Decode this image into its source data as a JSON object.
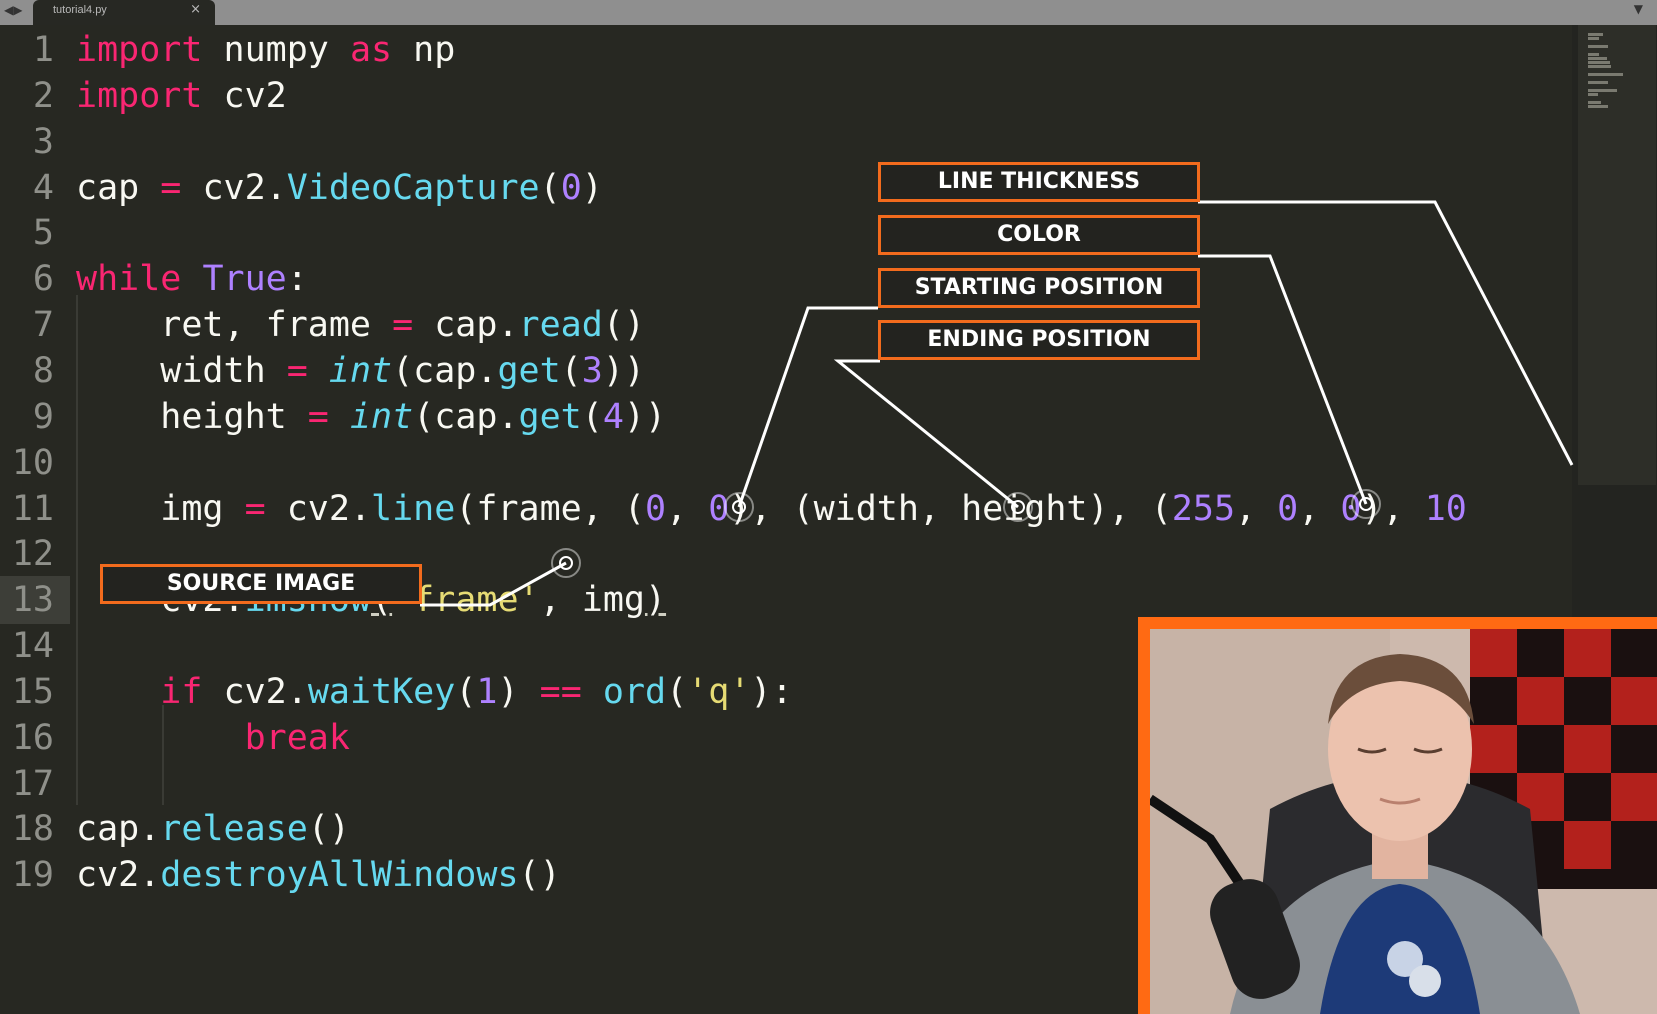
{
  "tab": {
    "filename": "tutorial4.py",
    "close_glyph": "×"
  },
  "line_numbers": [
    "1",
    "2",
    "3",
    "4",
    "5",
    "6",
    "7",
    "8",
    "9",
    "10",
    "11",
    "12",
    "13",
    "14",
    "15",
    "16",
    "17",
    "18",
    "19"
  ],
  "code_lines": [
    [
      [
        "kw",
        "import"
      ],
      [
        "t",
        " numpy "
      ],
      [
        "kw",
        "as"
      ],
      [
        "t",
        " np"
      ]
    ],
    [
      [
        "kw",
        "import"
      ],
      [
        "t",
        " cv2"
      ]
    ],
    [],
    [
      [
        "t",
        "cap "
      ],
      [
        "op",
        "="
      ],
      [
        "t",
        " cv2."
      ],
      [
        "fn",
        "VideoCapture"
      ],
      [
        "t",
        "("
      ],
      [
        "num",
        "0"
      ],
      [
        "t",
        ")"
      ]
    ],
    [],
    [
      [
        "kw",
        "while"
      ],
      [
        "t",
        " "
      ],
      [
        "const",
        "True"
      ],
      [
        "t",
        ":"
      ]
    ],
    [
      [
        "t",
        "    ret, frame "
      ],
      [
        "op",
        "="
      ],
      [
        "t",
        " cap."
      ],
      [
        "fn",
        "read"
      ],
      [
        "t",
        "()"
      ]
    ],
    [
      [
        "t",
        "    width "
      ],
      [
        "op",
        "="
      ],
      [
        "t",
        " "
      ],
      [
        "builtin",
        "int"
      ],
      [
        "t",
        "(cap."
      ],
      [
        "fn",
        "get"
      ],
      [
        "t",
        "("
      ],
      [
        "num",
        "3"
      ],
      [
        "t",
        "))"
      ]
    ],
    [
      [
        "t",
        "    height "
      ],
      [
        "op",
        "="
      ],
      [
        "t",
        " "
      ],
      [
        "builtin",
        "int"
      ],
      [
        "t",
        "(cap."
      ],
      [
        "fn",
        "get"
      ],
      [
        "t",
        "("
      ],
      [
        "num",
        "4"
      ],
      [
        "t",
        "))"
      ]
    ],
    [],
    [
      [
        "t",
        "    img "
      ],
      [
        "op",
        "="
      ],
      [
        "t",
        " cv2."
      ],
      [
        "fn",
        "line"
      ],
      [
        "t",
        "(frame, ("
      ],
      [
        "num",
        "0"
      ],
      [
        "t",
        ", "
      ],
      [
        "num",
        "0"
      ],
      [
        "t",
        "), (width, height), ("
      ],
      [
        "num",
        "255"
      ],
      [
        "t",
        ", "
      ],
      [
        "num",
        "0"
      ],
      [
        "t",
        ", "
      ],
      [
        "num",
        "0"
      ],
      [
        "t",
        "), "
      ],
      [
        "num",
        "10"
      ]
    ],
    [],
    [
      [
        "t",
        "    cv2."
      ],
      [
        "fn",
        "imshow"
      ],
      [
        "u",
        "("
      ],
      [
        "str",
        "'frame'"
      ],
      [
        "t",
        ", img"
      ],
      [
        "u",
        ")"
      ]
    ],
    [],
    [
      [
        "t",
        "    "
      ],
      [
        "kw",
        "if"
      ],
      [
        "t",
        " cv2."
      ],
      [
        "fn",
        "waitKey"
      ],
      [
        "t",
        "("
      ],
      [
        "num",
        "1"
      ],
      [
        "t",
        ") "
      ],
      [
        "op",
        "=="
      ],
      [
        "t",
        " "
      ],
      [
        "fn",
        "ord"
      ],
      [
        "t",
        "("
      ],
      [
        "str",
        "'q'"
      ],
      [
        "t",
        "):"
      ]
    ],
    [
      [
        "t",
        "        "
      ],
      [
        "kw",
        "break"
      ]
    ],
    [],
    [
      [
        "t",
        "cap."
      ],
      [
        "fn",
        "release"
      ],
      [
        "t",
        "()"
      ]
    ],
    [
      [
        "t",
        "cv2."
      ],
      [
        "fn",
        "destroyAllWindows"
      ],
      [
        "t",
        "()"
      ]
    ]
  ],
  "annotations": {
    "line_thickness": "LINE THICKNESS",
    "color": "COLOR",
    "starting_position": "STARTING POSITION",
    "ending_position": "ENDING POSITION",
    "source_image": "SOURCE IMAGE"
  },
  "colors": {
    "accent": "#f26b1d",
    "keyword": "#f92672",
    "function": "#66d9ef",
    "number": "#ae81ff",
    "string": "#e6db74",
    "text": "#f8f8f2",
    "background": "#272822"
  },
  "active_line": 13,
  "icons": {
    "tab_close": "close-icon",
    "webcam": "webcam-overlay"
  }
}
